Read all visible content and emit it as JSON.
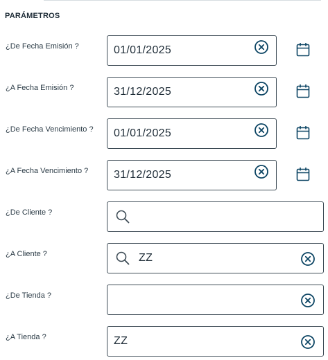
{
  "section": {
    "title": "PARÁMETROS"
  },
  "params": [
    {
      "label": "¿De Fecha Emisión ?",
      "value": "01/01/2025"
    },
    {
      "label": "¿A Fecha Emisión ?",
      "value": "31/12/2025"
    },
    {
      "label": "¿De Fecha Vencimiento ?",
      "value": "01/01/2025"
    },
    {
      "label": "¿A Fecha Vencimiento ?",
      "value": "31/12/2025"
    },
    {
      "label": "¿De Cliente ?",
      "value": ""
    },
    {
      "label": "¿A Cliente ?",
      "value": "ZZ"
    },
    {
      "label": "¿De Tienda ?",
      "value": ""
    },
    {
      "label": "¿A Tienda ?",
      "value": "ZZ"
    }
  ],
  "icons": {
    "clear": "close-circle-icon",
    "calendar": "calendar-icon",
    "search": "search-icon"
  },
  "colors": {
    "icon": "#0b4463",
    "border": "#3d4b55"
  }
}
